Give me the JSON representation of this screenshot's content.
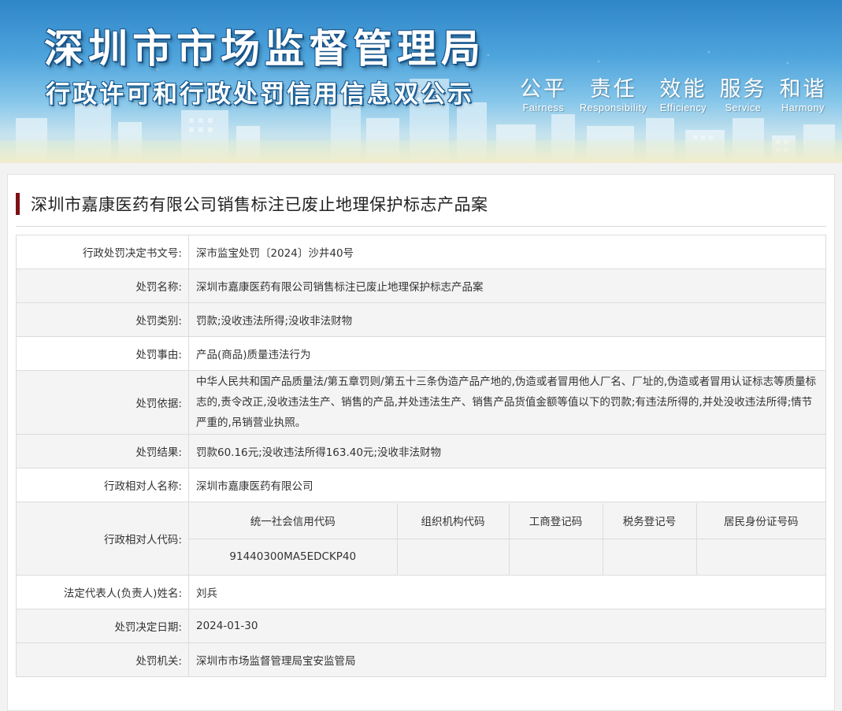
{
  "banner": {
    "title_main": "深圳市市场监督管理局",
    "title_sub": "行政许可和行政处罚信用信息双公示",
    "slogans": [
      {
        "cn": "公平",
        "en": "Fairness"
      },
      {
        "cn": "责任",
        "en": "Responsibility"
      },
      {
        "cn": "效能",
        "en": "Efficiency"
      },
      {
        "cn": "服务",
        "en": "Service"
      },
      {
        "cn": "和谐",
        "en": "Harmony"
      }
    ]
  },
  "case": {
    "title": "深圳市嘉康医药有限公司销售标注已废止地理保护标志产品案"
  },
  "rows": {
    "doc_no": {
      "label": "行政处罚决定书文号:",
      "value": "深市监宝处罚〔2024〕沙井40号"
    },
    "name": {
      "label": "处罚名称:",
      "value": "深圳市嘉康医药有限公司销售标注已废止地理保护标志产品案"
    },
    "category": {
      "label": "处罚类别:",
      "value": "罚款;没收违法所得;没收非法财物"
    },
    "reason": {
      "label": "处罚事由:",
      "value": "产品(商品)质量违法行为"
    },
    "basis": {
      "label": "处罚依据:",
      "value": "中华人民共和国产品质量法/第五章罚则/第五十三条伪造产品产地的,伪造或者冒用他人厂名、厂址的,伪造或者冒用认证标志等质量标志的,责令改正,没收违法生产、销售的产品,并处违法生产、销售产品货值金额等值以下的罚款;有违法所得的,并处没收违法所得;情节严重的,吊销营业执照。"
    },
    "result": {
      "label": "处罚结果:",
      "value": "罚款60.16元;没收违法所得163.40元;没收非法财物"
    },
    "party_name": {
      "label": "行政相对人名称:",
      "value": "深圳市嘉康医药有限公司"
    },
    "party_code": {
      "label": "行政相对人代码:",
      "headers": [
        "统一社会信用代码",
        "组织机构代码",
        "工商登记码",
        "税务登记号",
        "居民身份证号码"
      ],
      "values": [
        "91440300MA5EDCKP40",
        "",
        "",
        "",
        ""
      ]
    },
    "legal_rep": {
      "label": "法定代表人(负责人)姓名:",
      "value": "刘兵"
    },
    "decision_date": {
      "label": "处罚决定日期:",
      "value": "2024-01-30"
    },
    "authority": {
      "label": "处罚机关:",
      "value": "深圳市市场监督管理局宝安监管局"
    }
  }
}
